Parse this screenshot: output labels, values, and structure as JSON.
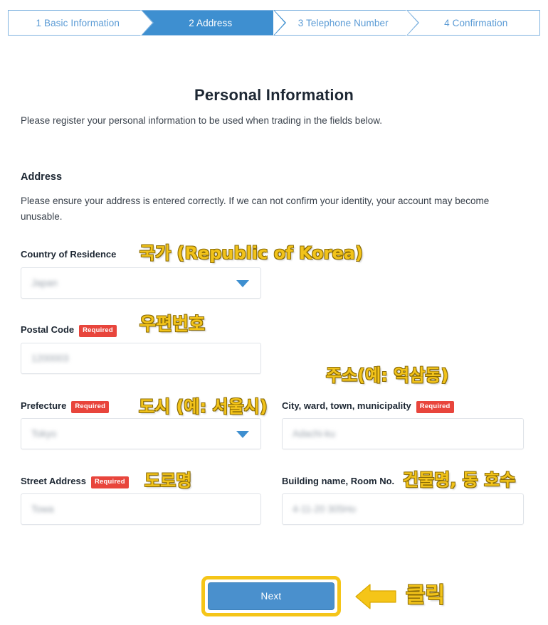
{
  "stepper": {
    "steps": [
      {
        "label": "1 Basic Information",
        "active": false
      },
      {
        "label": "2 Address",
        "active": true
      },
      {
        "label": "3 Telephone Number",
        "active": false
      },
      {
        "label": "4 Confirmation",
        "active": false
      }
    ]
  },
  "page": {
    "title": "Personal Information",
    "subtitle": "Please register your personal information to be used when trading in the fields below.",
    "section_title": "Address",
    "section_desc": "Please ensure your address is entered correctly. If we can not confirm your identity, your account may become unusable."
  },
  "form": {
    "required_badge": "Required",
    "country": {
      "label": "Country of Residence",
      "value": "Japan",
      "annotation": "국가 (Republic of Korea)"
    },
    "postal_code": {
      "label": "Postal Code",
      "value": "1200003",
      "annotation": "우편번호"
    },
    "prefecture": {
      "label": "Prefecture",
      "value": "Tokyo",
      "annotation": "도시 (예: 서울시)"
    },
    "city": {
      "label": "City, ward, town, municipality",
      "value": "Adachi-ku",
      "annotation": "주소(예: 역삼동)"
    },
    "street": {
      "label": "Street Address",
      "value": "Towa",
      "annotation": "도로명"
    },
    "building": {
      "label": "Building name, Room No.",
      "value": "4-11-20  305Ho",
      "annotation": "건물명, 동 호수"
    }
  },
  "footer": {
    "next_label": "Next",
    "click_annotation": "클릭"
  },
  "colors": {
    "accent_blue": "#3e8fd0",
    "button_blue": "#4a90cd",
    "required_red": "#e8453c",
    "annotation_yellow": "#f2c31a",
    "highlight_yellow": "#f5c518"
  }
}
